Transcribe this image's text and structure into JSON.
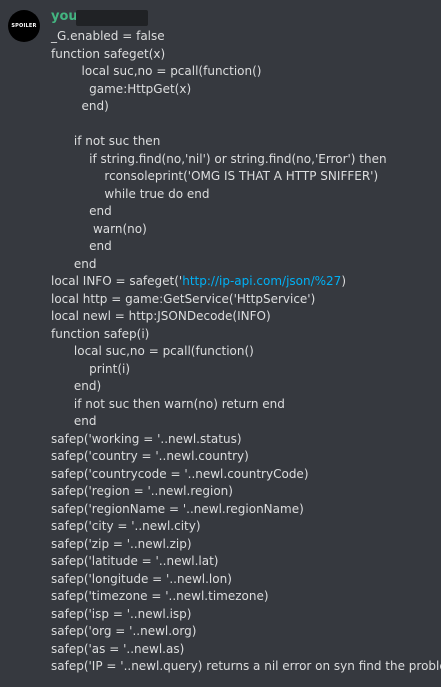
{
  "author": {
    "name": "you",
    "avatar_text": "SPOILER",
    "name_color": "#43b581"
  },
  "colors": {
    "background": "#36393f",
    "text": "#dcddde",
    "link": "#00b0f4",
    "redaction": "#202225"
  },
  "message": {
    "lines": [
      "_G.enabled = false",
      "function safeget(x)",
      "        local suc,no = pcall(function()",
      "          game:HttpGet(x)",
      "        end)",
      "",
      "      if not suc then",
      "          if string.find(no,'nil') or string.find(no,'Error') then",
      "              rconsoleprint('OMG IS THAT A HTTP SNIFFER')",
      "              while true do end",
      "          end",
      "           warn(no)",
      "          end",
      "      end",
      {
        "pre": "local INFO = safeget('",
        "link": "http://ip-api.com/json/%27",
        "post": ")"
      },
      "local http = game:GetService('HttpService')",
      "local newl = http:JSONDecode(INFO)",
      "function safep(i)",
      "      local suc,no = pcall(function()",
      "          print(i)",
      "      end)",
      "      if not suc then warn(no) return end",
      "      end",
      "safep('working = '..newl.status)",
      "safep('country = '..newl.country)",
      "safep('countrycode = '..newl.countryCode)",
      "safep('region = '..newl.region)",
      "safep('regionName = '..newl.regionName)",
      "safep('city = '..newl.city)",
      "safep('zip = '..newl.zip)",
      "safep('latitude = '..newl.lat)",
      "safep('longitude = '..newl.lon)",
      "safep('timezone = '..newl.timezone)",
      "safep('isp = '..newl.isp)",
      "safep('org = '..newl.org)",
      "safep('as = '..newl.as)",
      "safep('IP = '..newl.query) returns a nil error on syn find the problem"
    ]
  }
}
